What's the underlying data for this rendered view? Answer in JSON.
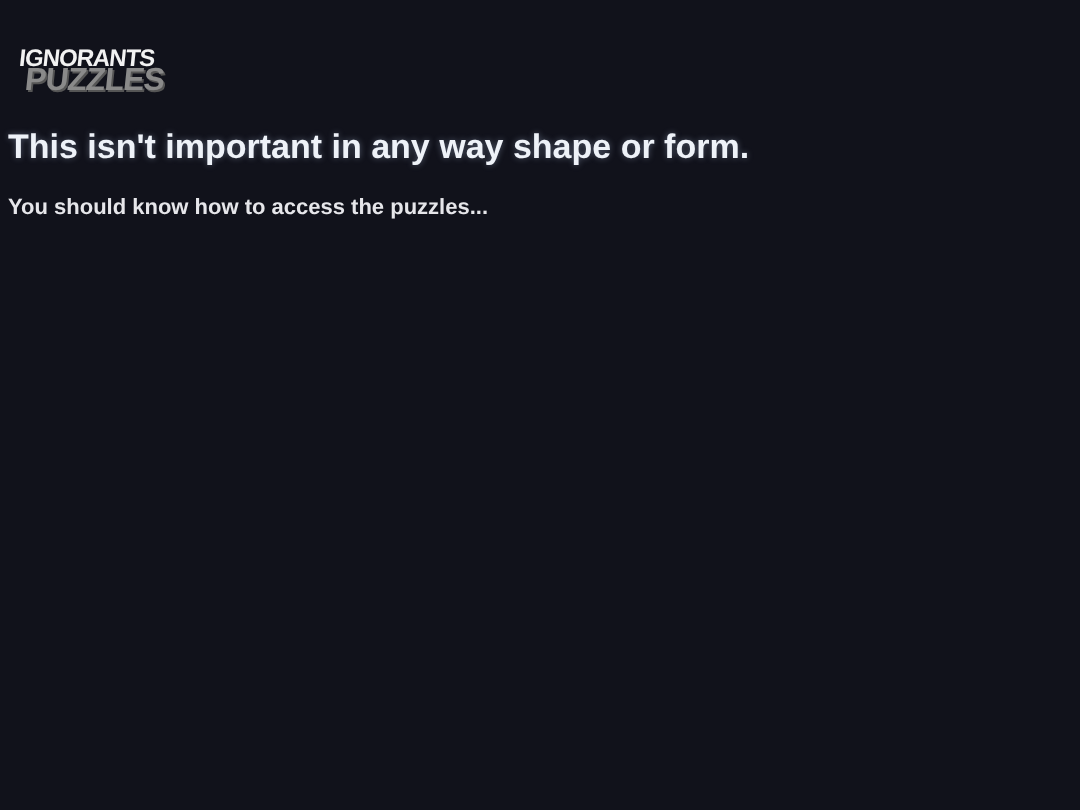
{
  "logo": {
    "line_1": "IGNORANTS",
    "line_2": "PUZZLES"
  },
  "heading": "This isn't important in any way shape or form.",
  "message": "You should know how to access the puzzles..."
}
